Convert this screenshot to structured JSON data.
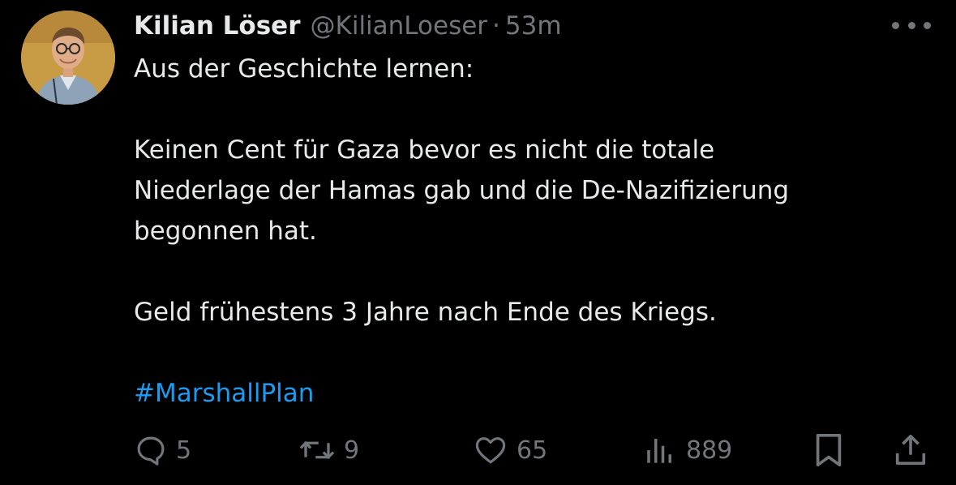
{
  "tweet": {
    "author": {
      "display_name": "Kilian Löser",
      "handle": "@KilianLoeser",
      "separator": "·",
      "time": "53m"
    },
    "text_lines": [
      "Aus der Geschichte lernen:",
      "",
      "Keinen Cent für Gaza bevor es nicht die totale",
      "Niederlage der Hamas gab und die De-Nazifizierung",
      "begonnen hat.",
      "",
      "Geld frühestens 3 Jahre nach Ende des Kriegs.",
      ""
    ],
    "hashtag": "#MarshallPlan",
    "hashtag_color": "#1d9bf0",
    "stats": {
      "replies": "5",
      "reposts": "9",
      "likes": "65",
      "views": "889"
    },
    "icons": [
      "more-icon",
      "reply-icon",
      "repost-icon",
      "like-icon",
      "views-icon",
      "bookmark-icon",
      "share-icon"
    ]
  }
}
